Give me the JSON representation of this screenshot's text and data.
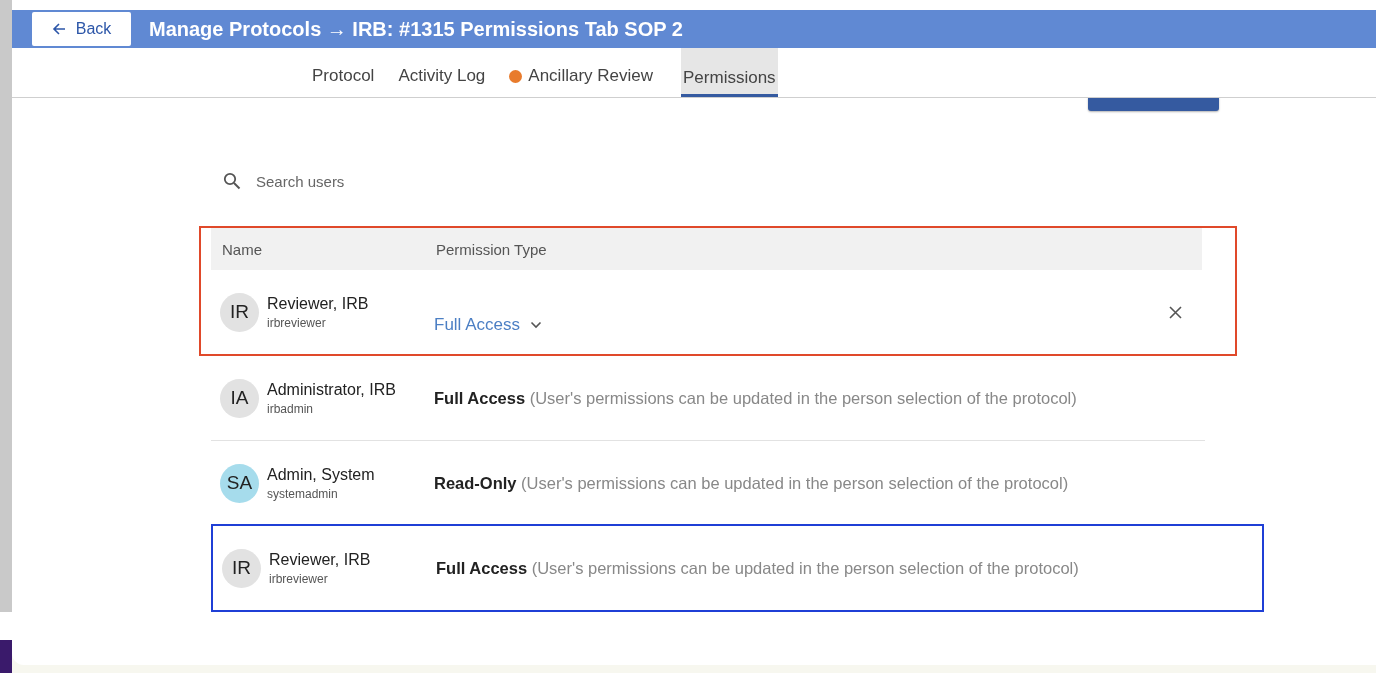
{
  "header": {
    "back_label": "Back",
    "title": "Manage Protocols → IRB: #1315 Permissions Tab SOP 2"
  },
  "tabs": [
    {
      "label": "Protocol",
      "selected": false
    },
    {
      "label": "Activity Log",
      "selected": false
    },
    {
      "label": "Ancillary Review",
      "selected": false,
      "dot": {
        "color": "#e87b2c"
      }
    },
    {
      "label": "Permissions",
      "selected": true
    }
  ],
  "search": {
    "placeholder": "Search users"
  },
  "table": {
    "columns": [
      "Name",
      "Permission Type"
    ],
    "header_highlight": {
      "color": "#e0492a"
    },
    "rows": [
      {
        "kind": "editable",
        "avatar": {
          "initials": "IR",
          "color": "#e2e2e2"
        },
        "name": "Reviewer, IRB",
        "username": "irbreviewer",
        "permission": "Full Access",
        "highlight": {
          "color": "#e0492a"
        }
      },
      {
        "kind": "fixed",
        "avatar": {
          "initials": "IA",
          "color": "#e2e2e2"
        },
        "name": "Administrator, IRB",
        "username": "irbadmin",
        "permission": "Full Access",
        "note": "(User's permissions can be updated in the person selection of the protocol)"
      },
      {
        "kind": "fixed",
        "avatar": {
          "initials": "SA",
          "color": "#a6dcec"
        },
        "name": "Admin, System",
        "username": "systemadmin",
        "permission": "Read-Only",
        "note": "(User's permissions can be updated in the person selection of the protocol)"
      },
      {
        "kind": "fixed",
        "avatar": {
          "initials": "IR",
          "color": "#e2e2e2"
        },
        "name": "Reviewer, IRB",
        "username": "irbreviewer",
        "permission": "Full Access",
        "note": "(User's permissions can be updated in the person selection of the protocol)",
        "highlight": {
          "color": "#1f3fd6"
        }
      }
    ]
  }
}
